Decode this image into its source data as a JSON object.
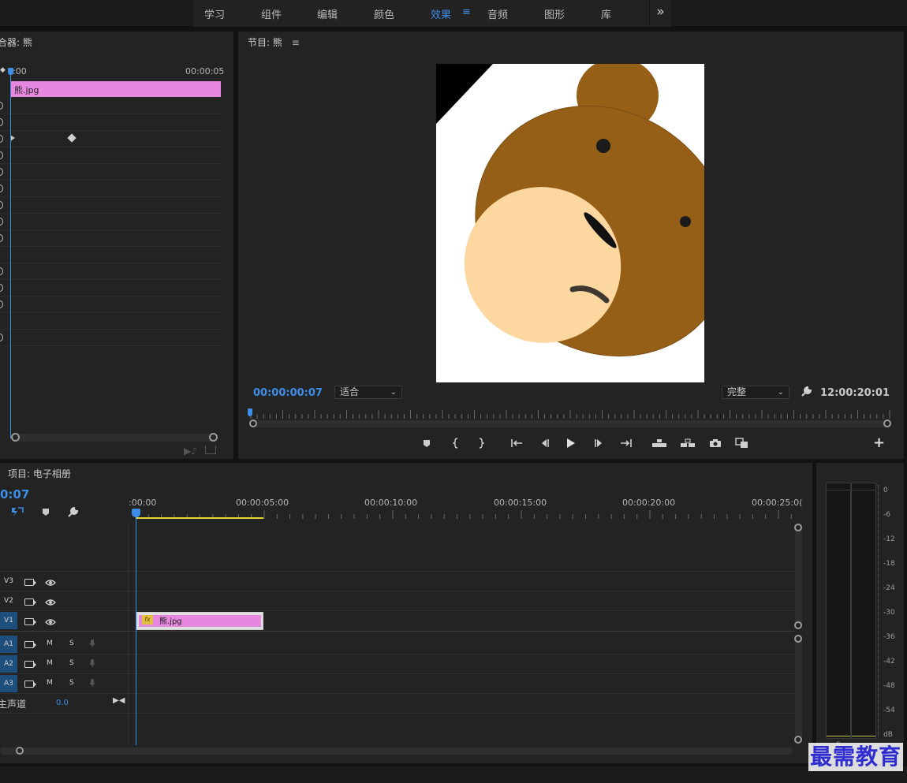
{
  "workspace_tabs": [
    {
      "label": "学习"
    },
    {
      "label": "组件"
    },
    {
      "label": "编辑"
    },
    {
      "label": "颜色"
    },
    {
      "label": "效果",
      "active": true
    },
    {
      "label": "音频"
    },
    {
      "label": "图形"
    },
    {
      "label": "库"
    }
  ],
  "more_glyph": "»",
  "menu_glyph": "≡",
  "effect_controls": {
    "title": "合器: 熊",
    "ruler_start": ":00",
    "ruler_end": "00:00:05",
    "clip_name": "熊.jpg",
    "keyframe_row_count": 15
  },
  "program_monitor": {
    "title": "节目: 熊",
    "timecode": "00:00:00:07",
    "fit_option": "适合",
    "quality_option": "完整",
    "duration": "12:00:20:01",
    "add_glyph": "+"
  },
  "project_panel": {
    "title": "项目: 电子相册"
  },
  "timeline": {
    "timecode": "0:07",
    "ruler_labels": [
      ":00:00",
      "00:00:05:00",
      "00:00:10:00",
      "00:00:15:00",
      "00:00:20:00",
      "00:00:25:0("
    ],
    "video_tracks": [
      {
        "name": "V3",
        "targeted": false
      },
      {
        "name": "V2",
        "targeted": false
      },
      {
        "name": "V1",
        "targeted": true
      }
    ],
    "audio_tracks": [
      {
        "name": "A1",
        "mute": "M",
        "solo": "S"
      },
      {
        "name": "A2",
        "mute": "M",
        "solo": "S"
      },
      {
        "name": "A3",
        "mute": "M",
        "solo": "S"
      }
    ],
    "master_label": "主声道",
    "master_value": "0.0",
    "clip": {
      "name": "熊.jpg",
      "fx_badge": "fx",
      "color": "#e687e0"
    }
  },
  "audio_meter": {
    "scale": [
      "0",
      "-6",
      "-12",
      "-18",
      "-24",
      "-30",
      "-36",
      "-42",
      "-48",
      "-54",
      "dB"
    ],
    "bottom_label": "S"
  },
  "watermark": "最需教育",
  "colors": {
    "accent_blue": "#3d8ee8",
    "clip_pink": "#e687e0",
    "bear_brown": "#955f17",
    "bear_muzzle": "#fdd7a0",
    "work_area_yellow": "#e6d636"
  }
}
